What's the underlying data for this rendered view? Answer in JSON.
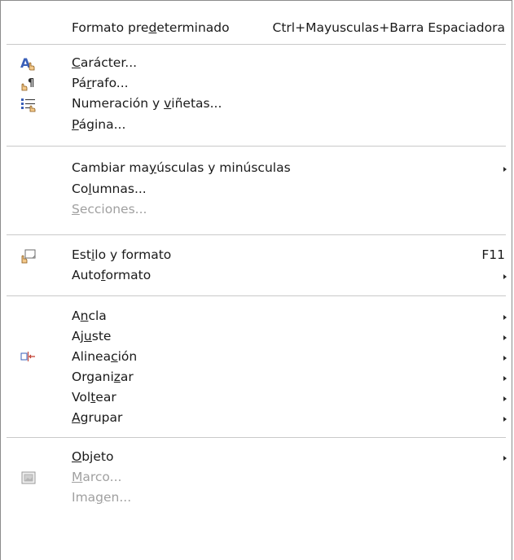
{
  "menu": {
    "default_format": {
      "pre": "Formato pre",
      "ul": "d",
      "post": "eterminado",
      "shortcut": "Ctrl+Mayusculas+Barra Espaciadora"
    },
    "character": {
      "pre": "",
      "ul": "C",
      "post": "arácter...",
      "icon": "character-icon"
    },
    "paragraph": {
      "pre": "Pá",
      "ul": "r",
      "post": "rafo...",
      "icon": "paragraph-icon"
    },
    "numbering": {
      "pre": "Numeración y ",
      "ul": "v",
      "post": "iñetas...",
      "icon": "bullets-numbering-icon"
    },
    "page": {
      "pre": "",
      "ul": "P",
      "post": "ágina..."
    },
    "change_case": {
      "pre": "Cambiar ma",
      "ul": "y",
      "post": "úsculas y minúsculas"
    },
    "columns": {
      "pre": "Co",
      "ul": "l",
      "post": "umnas..."
    },
    "sections": {
      "pre": "",
      "ul": "S",
      "post": "ecciones..."
    },
    "style_format": {
      "pre": "Est",
      "ul": "i",
      "post": "lo y formato",
      "shortcut": "F11",
      "icon": "styles-formatting-icon"
    },
    "autoformat": {
      "pre": "Auto",
      "ul": "f",
      "post": "ormato"
    },
    "anchor": {
      "pre": "A",
      "ul": "n",
      "post": "cla"
    },
    "wrap": {
      "pre": "Aj",
      "ul": "u",
      "post": "ste"
    },
    "alignment": {
      "pre": "Alinea",
      "ul": "c",
      "post": "ión",
      "icon": "alignment-icon"
    },
    "arrange": {
      "pre": "Organi",
      "ul": "z",
      "post": "ar"
    },
    "flip": {
      "pre": "Vol",
      "ul": "t",
      "post": "ear"
    },
    "group": {
      "pre": "",
      "ul": "A",
      "post": "grupar"
    },
    "object": {
      "pre": "",
      "ul": "O",
      "post": "bjeto"
    },
    "frame": {
      "pre": "",
      "ul": "M",
      "post": "arco...",
      "icon": "frame-icon"
    },
    "image": {
      "pre": "Ima",
      "ul": "g",
      "post": "en..."
    }
  },
  "colors": {
    "text": "#1a1a1a",
    "disabled": "#a0a0a0",
    "separator": "#c9c9c9",
    "icon_blue": "#3a5fb8",
    "icon_orange": "#d98a1b"
  }
}
